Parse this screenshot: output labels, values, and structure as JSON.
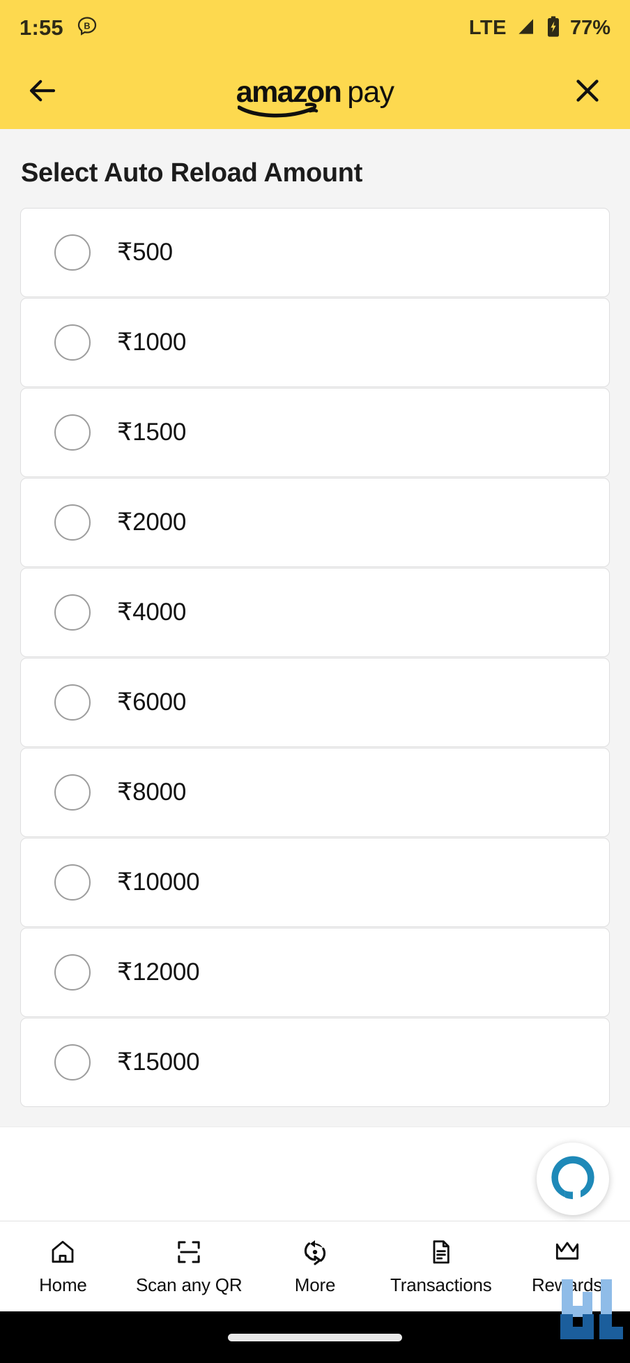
{
  "status_bar": {
    "time": "1:55",
    "notification_icon": "chat-bubble-b-icon",
    "network": "LTE",
    "signal_icon": "signal-bars-icon",
    "battery_icon": "battery-charging-icon",
    "battery_percent": "77%",
    "background_color": "#fdd94f",
    "text_color": "#2e2a17"
  },
  "appbar": {
    "back_icon": "back-arrow-icon",
    "close_icon": "close-x-icon",
    "brand_primary": "amazon",
    "brand_secondary": "pay",
    "background_color": "#fdd94f"
  },
  "page": {
    "title": "Select Auto Reload Amount",
    "background_color": "#f4f4f4"
  },
  "amounts": [
    {
      "label": "₹500",
      "value": 500,
      "selected": false
    },
    {
      "label": "₹1000",
      "value": 1000,
      "selected": false
    },
    {
      "label": "₹1500",
      "value": 1500,
      "selected": false
    },
    {
      "label": "₹2000",
      "value": 2000,
      "selected": false
    },
    {
      "label": "₹4000",
      "value": 4000,
      "selected": false
    },
    {
      "label": "₹6000",
      "value": 6000,
      "selected": false
    },
    {
      "label": "₹8000",
      "value": 8000,
      "selected": false
    },
    {
      "label": "₹10000",
      "value": 10000,
      "selected": false
    },
    {
      "label": "₹12000",
      "value": 12000,
      "selected": false
    },
    {
      "label": "₹15000",
      "value": 15000,
      "selected": false
    }
  ],
  "assistant": {
    "icon": "alexa-icon",
    "accent_color": "#1e89b8"
  },
  "bottom_nav": {
    "items": [
      {
        "label": "Home",
        "icon": "home-icon"
      },
      {
        "label": "Scan any QR",
        "icon": "qr-scan-icon"
      },
      {
        "label": "More",
        "icon": "refresh-circle-icon"
      },
      {
        "label": "Transactions",
        "icon": "document-icon"
      },
      {
        "label": "Rewards",
        "icon": "crown-icon"
      }
    ]
  },
  "watermark": {
    "icon": "gj-logo-watermark",
    "color": "#1b5e9c"
  },
  "gesture_bar": {
    "icon": "gesture-pill-icon"
  }
}
